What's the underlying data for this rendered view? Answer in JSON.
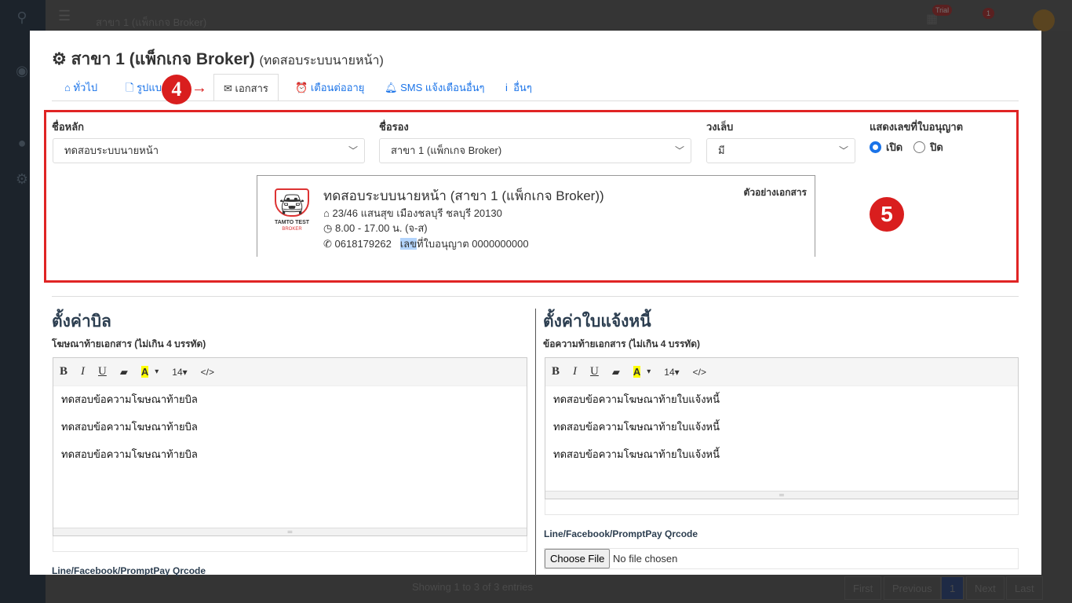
{
  "topbar": {
    "branch": "สาขา 1 (แพ็กเกจ Broker)",
    "badge1": "Trial",
    "badge2": "1"
  },
  "background": {
    "entries": "Showing 1 to 3 of 3 entries",
    "pager": [
      "First",
      "Previous",
      "1",
      "Next",
      "Last"
    ]
  },
  "modal": {
    "title": "สาขา 1 (แพ็กเกจ Broker)",
    "subtitle": "(ทดสอบระบบนายหน้า)",
    "tabs": [
      {
        "label": "ทั่วไป",
        "icon": "home-icon"
      },
      {
        "label": "รูปแบบ...",
        "icon": "file-icon"
      },
      {
        "label": "เอกสาร",
        "icon": "envelope-icon",
        "active": true
      },
      {
        "label": "เตือนต่ออายุ",
        "icon": "alarm-icon"
      },
      {
        "label": "SMS แจ้งเตือนอื่นๆ",
        "icon": "bell-icon"
      },
      {
        "label": "อื่นๆ",
        "icon": "info-icon"
      }
    ],
    "step4": "4",
    "step5": "5",
    "fields": {
      "main_name": {
        "label": "ชื่อหลัก",
        "value": "ทดสอบระบบนายหน้า"
      },
      "sub_name": {
        "label": "ชื่อรอง",
        "value": "สาขา 1 (แพ็กเกจ Broker)"
      },
      "bracket": {
        "label": "วงเล็บ",
        "value": "มี"
      },
      "show_license": {
        "label": "แสดงเลขที่ใบอนุญาต",
        "on": "เปิด",
        "off": "ปิด",
        "selected": "เปิด"
      }
    },
    "preview": {
      "logo_line1": "TAMTO TEST",
      "logo_line2": "BROKER",
      "name": "ทดสอบระบบนายหน้า (สาขา 1 (แพ็กเกจ Broker))",
      "address": "23/46 แสนสุข เมืองชลบุรี ชลบุรี 20130",
      "hours": "8.00 - 17.00 น. (จ-ส)",
      "phone": "0618179262",
      "license_hl": "เลข",
      "license": "ที่ใบอนุญาต 0000000000",
      "tag": "ตัวอย่างเอกสาร"
    },
    "toolbar": {
      "bold": "B",
      "italic": "I",
      "underline": "U",
      "eraser": "▰",
      "color": "A",
      "caret": "▾",
      "size": "14▾",
      "code": "</>"
    },
    "bill": {
      "heading": "ตั้งค่าบิล",
      "label": "โฆษณาท้ายเอกสาร (ไม่เกิน 4 บรรทัด)",
      "lines": [
        "ทดสอบข้อความโฆษณาท้ายบิล",
        "ทดสอบข้อความโฆษณาท้ายบิล",
        "ทดสอบข้อความโฆษณาท้ายบิล"
      ],
      "qr_label": "Line/Facebook/PromptPay Qrcode"
    },
    "invoice": {
      "heading": "ตั้งค่าใบแจ้งหนี้",
      "label": "ข้อความท้ายเอกสาร (ไม่เกิน 4 บรรทัด)",
      "lines": [
        "ทดสอบข้อความโฆษณาท้ายใบแจ้งหนี้",
        "ทดสอบข้อความโฆษณาท้ายใบแจ้งหนี้",
        "ทดสอบข้อความโฆษณาท้ายใบแจ้งหนี้"
      ],
      "qr_label": "Line/Facebook/PromptPay Qrcode",
      "file_button": "Choose File",
      "file_status": "No file chosen"
    }
  },
  "colors": {
    "accent": "#1a73e8",
    "highlight": "#e02424"
  }
}
